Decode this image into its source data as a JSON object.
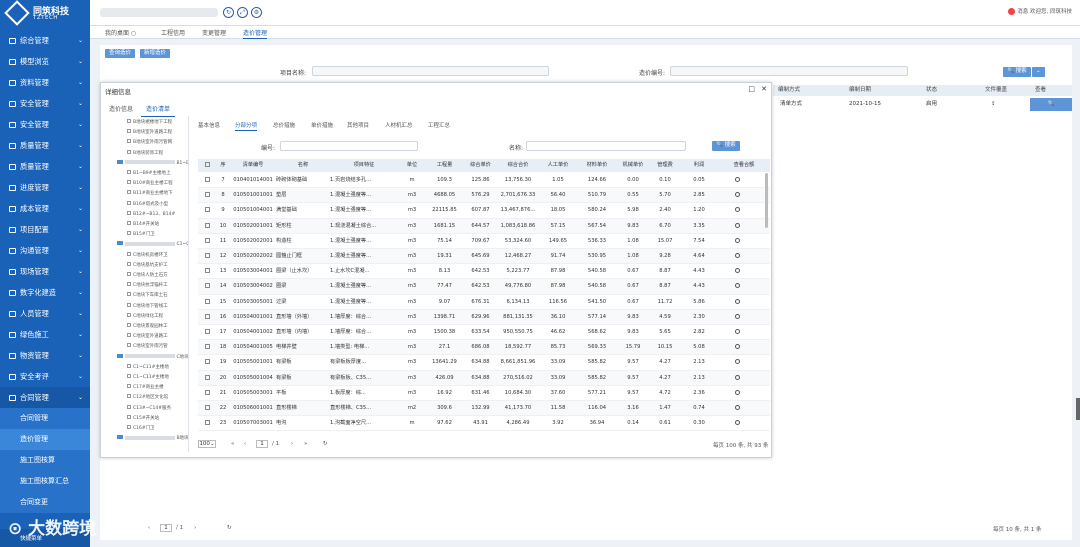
{
  "header": {
    "brand": "同筑科技",
    "brand_sub": "TZTECH",
    "user_text": "欢迎您, 同筑科技",
    "badge": "消息",
    "icons": [
      "refresh-icon",
      "expand-icon",
      "settings-icon"
    ]
  },
  "top_tabs": [
    {
      "label": "我的桌面"
    },
    {
      "label": "工程信用"
    },
    {
      "label": "变更管理"
    },
    {
      "label": "造价管理"
    }
  ],
  "sidebar": {
    "items": [
      {
        "label": "综合管理"
      },
      {
        "label": "模型浏览"
      },
      {
        "label": "资料管理"
      },
      {
        "label": "安全管理"
      },
      {
        "label": "安全管理"
      },
      {
        "label": "质量管理"
      },
      {
        "label": "质量管理"
      },
      {
        "label": "进度管理"
      },
      {
        "label": "成本管理"
      },
      {
        "label": "项目配置"
      },
      {
        "label": "沟通管理"
      },
      {
        "label": "现场管理"
      },
      {
        "label": "数字化建造"
      },
      {
        "label": "人员管理"
      },
      {
        "label": "绿色施工"
      },
      {
        "label": "物资管理"
      },
      {
        "label": "安全考评"
      },
      {
        "label": "合同管理"
      }
    ],
    "sub_items": [
      {
        "label": "合同管理"
      },
      {
        "label": "造价管理"
      },
      {
        "label": "施工图核算"
      },
      {
        "label": "施工图核算汇总"
      },
      {
        "label": "合同变更"
      }
    ],
    "footer": "快捷菜单"
  },
  "main": {
    "buttons": {
      "query": "查询造价",
      "new": "新增造价"
    },
    "search": {
      "project_label": "项目名称:",
      "code_label": "造价编号:",
      "search_btn": "搜索"
    },
    "right_table": {
      "headers": [
        "编制方式",
        "编制日期",
        "状态",
        "文件覆盖",
        "查看"
      ],
      "row": [
        "清单方式",
        "2021-10-15",
        "启用"
      ]
    },
    "bottom_pager": {
      "page": "1",
      "total": "/ 1",
      "summary": "每页 10 条, 共 1 条"
    }
  },
  "dialog": {
    "title": "详细信息",
    "tabs": [
      {
        "label": "造价信息"
      },
      {
        "label": "造价清单"
      }
    ],
    "sub_tabs": [
      {
        "label": "基本信息"
      },
      {
        "label": "分部分项"
      },
      {
        "label": "总价措施"
      },
      {
        "label": "单价措施"
      },
      {
        "label": "其他项目"
      },
      {
        "label": "人材机汇总"
      },
      {
        "label": "工程汇总"
      }
    ],
    "filters": {
      "code_label": "编号:",
      "name_label": "名称:",
      "search_btn": "搜索"
    },
    "tree": [
      {
        "text": "B地块裙楼地下工程"
      },
      {
        "text": "B地块室外道路工程"
      },
      {
        "text": "B地块室外雨污管网"
      },
      {
        "text": "B地块装饰工程"
      },
      {
        "text": "B1~B9#主楼地下",
        "folder": true
      },
      {
        "text": "B1~B9#主楼地上"
      },
      {
        "text": "B10#商业主楼工程"
      },
      {
        "text": "B11#商业主楼地下"
      },
      {
        "text": "B16#塔式及小型"
      },
      {
        "text": "B12#~B13、B14#"
      },
      {
        "text": "B14#开关站"
      },
      {
        "text": "B15#门卫"
      },
      {
        "text": "C1~C8#地下",
        "folder": true
      },
      {
        "text": "C地块机房楼环卫"
      },
      {
        "text": "C地块基坑支护工"
      },
      {
        "text": "C地块人防土石方"
      },
      {
        "text": "C地块抗浮锚杆工"
      },
      {
        "text": "C地块下车库土石"
      },
      {
        "text": "C地块地下管线工"
      },
      {
        "text": "C地块绿化工程"
      },
      {
        "text": "C地块景观园林工"
      },
      {
        "text": "C地块室外道路工"
      },
      {
        "text": "C地块室外雨污管"
      },
      {
        "text": "C地块装饰工程",
        "folder": true
      },
      {
        "text": "C1~C11#主楼地"
      },
      {
        "text": "C1~C11#主楼地"
      },
      {
        "text": "C17#商业主楼"
      },
      {
        "text": "C12#地区文化馆"
      },
      {
        "text": "C13#~C14#服务"
      },
      {
        "text": "C15#开关站"
      },
      {
        "text": "C16#门卫"
      },
      {
        "text": "B地块地下室变电",
        "folder": true
      }
    ],
    "grid": {
      "headers": [
        "序",
        "清单编号",
        "名称",
        "项目特征",
        "单位",
        "工程量",
        "综合单价",
        "综合合价",
        "人工单价",
        "材料单价",
        "机械单价",
        "管理费",
        "利润",
        "查看合额"
      ],
      "rows": [
        [
          "7",
          "010401014001",
          "砖砌体砌基础",
          "1.页岩烧结多孔...",
          "m",
          "109.3",
          "125.86",
          "13,756.30",
          "1.05",
          "124.66",
          "0.00",
          "0.10",
          "0.05"
        ],
        [
          "8",
          "010501001001",
          "垫层",
          "1.混凝土强度等...",
          "m3",
          "4688.05",
          "576.29",
          "2,701,676.33",
          "56.40",
          "510.79",
          "0.55",
          "5.70",
          "2.85"
        ],
        [
          "9",
          "010501004001",
          "满堂基础",
          "1.混凝土强度等...",
          "m3",
          "22115.85",
          "607.87",
          "13,467,876...",
          "18.05",
          "580.24",
          "5.98",
          "2.40",
          "1.20"
        ],
        [
          "10",
          "010502001001",
          "矩形柱",
          "1.现浇混凝土综合...",
          "m3",
          "1681.15",
          "644.57",
          "1,083,618.86",
          "57.15",
          "567.54",
          "9.83",
          "6.70",
          "3.35"
        ],
        [
          "11",
          "010502002001",
          "构造柱",
          "1.混凝土强度等...",
          "m3",
          "75.14",
          "709.67",
          "53,324.60",
          "149.65",
          "536.33",
          "1.08",
          "15.07",
          "7.54"
        ],
        [
          "12",
          "010502002002",
          "圆箍止门框",
          "1.混凝土强度等...",
          "m3",
          "19.31",
          "645.69",
          "12,468.27",
          "91.74",
          "530.95",
          "1.08",
          "9.28",
          "4.64"
        ],
        [
          "13",
          "010503004001",
          "圈梁（止水坎）",
          "1.止水坎C混凝...",
          "m3",
          "8.13",
          "642.53",
          "5,223.77",
          "87.98",
          "540.58",
          "0.67",
          "8.87",
          "4.43"
        ],
        [
          "14",
          "010503004002",
          "圈梁",
          "1.混凝土强度等...",
          "m3",
          "77.47",
          "642.53",
          "49,776.80",
          "87.98",
          "540.58",
          "0.67",
          "8.87",
          "4.43"
        ],
        [
          "15",
          "010503005001",
          "过梁",
          "1.混凝土强度等...",
          "m3",
          "9.07",
          "676.31",
          "6,134.13",
          "116.56",
          "541.50",
          "0.67",
          "11.72",
          "5.86"
        ],
        [
          "16",
          "010504001001",
          "直形墙（外墙）",
          "1.墙厚度：综合...",
          "m3",
          "1398.71",
          "629.96",
          "881,131.35",
          "36.10",
          "577.14",
          "9.83",
          "4.59",
          "2.30"
        ],
        [
          "17",
          "010504001002",
          "直形墙（内墙）",
          "1.墙厚度：综合...",
          "m3",
          "1500.38",
          "633.54",
          "950,550.75",
          "46.62",
          "568.62",
          "9.83",
          "5.65",
          "2.82"
        ],
        [
          "18",
          "010504001005",
          "电梯井壁",
          "1.墙类型: 电梯...",
          "m3",
          "27.1",
          "686.08",
          "18,592.77",
          "85.73",
          "569.33",
          "15.79",
          "10.15",
          "5.08"
        ],
        [
          "19",
          "010505001001",
          "有梁板",
          "有梁板板厚度...",
          "m3",
          "13641.29",
          "634.88",
          "8,661,851.96",
          "33.09",
          "585.82",
          "9.57",
          "4.27",
          "2.13"
        ],
        [
          "20",
          "010505001004",
          "有梁板",
          "有梁板板、C35...",
          "m3",
          "426.09",
          "634.88",
          "270,516.02",
          "33.09",
          "585.82",
          "9.57",
          "4.27",
          "2.13"
        ],
        [
          "21",
          "010505003001",
          "平板",
          "1.板厚度：综...",
          "m3",
          "16.92",
          "631.46",
          "10,684.30",
          "37.60",
          "577.21",
          "9.57",
          "4.72",
          "2.36"
        ],
        [
          "22",
          "010506001001",
          "直形楼梯",
          "直形楼梯、C35...",
          "m2",
          "309.6",
          "132.99",
          "41,173.70",
          "11.58",
          "116.04",
          "3.16",
          "1.47",
          "0.74"
        ],
        [
          "23",
          "010507003001",
          "电沟",
          "1.沟截面净空尺...",
          "m",
          "97.62",
          "43.91",
          "4,286.49",
          "3.92",
          "36.94",
          "0.14",
          "0.61",
          "0.30"
        ]
      ]
    },
    "pager": {
      "page_size": "100",
      "page": "1",
      "total": "/ 1",
      "summary": "每页 100 条, 共 93 条"
    }
  },
  "watermark": "大数跨境",
  "colors": {
    "brand": "#1a62b8",
    "accent": "#5e95d8"
  }
}
